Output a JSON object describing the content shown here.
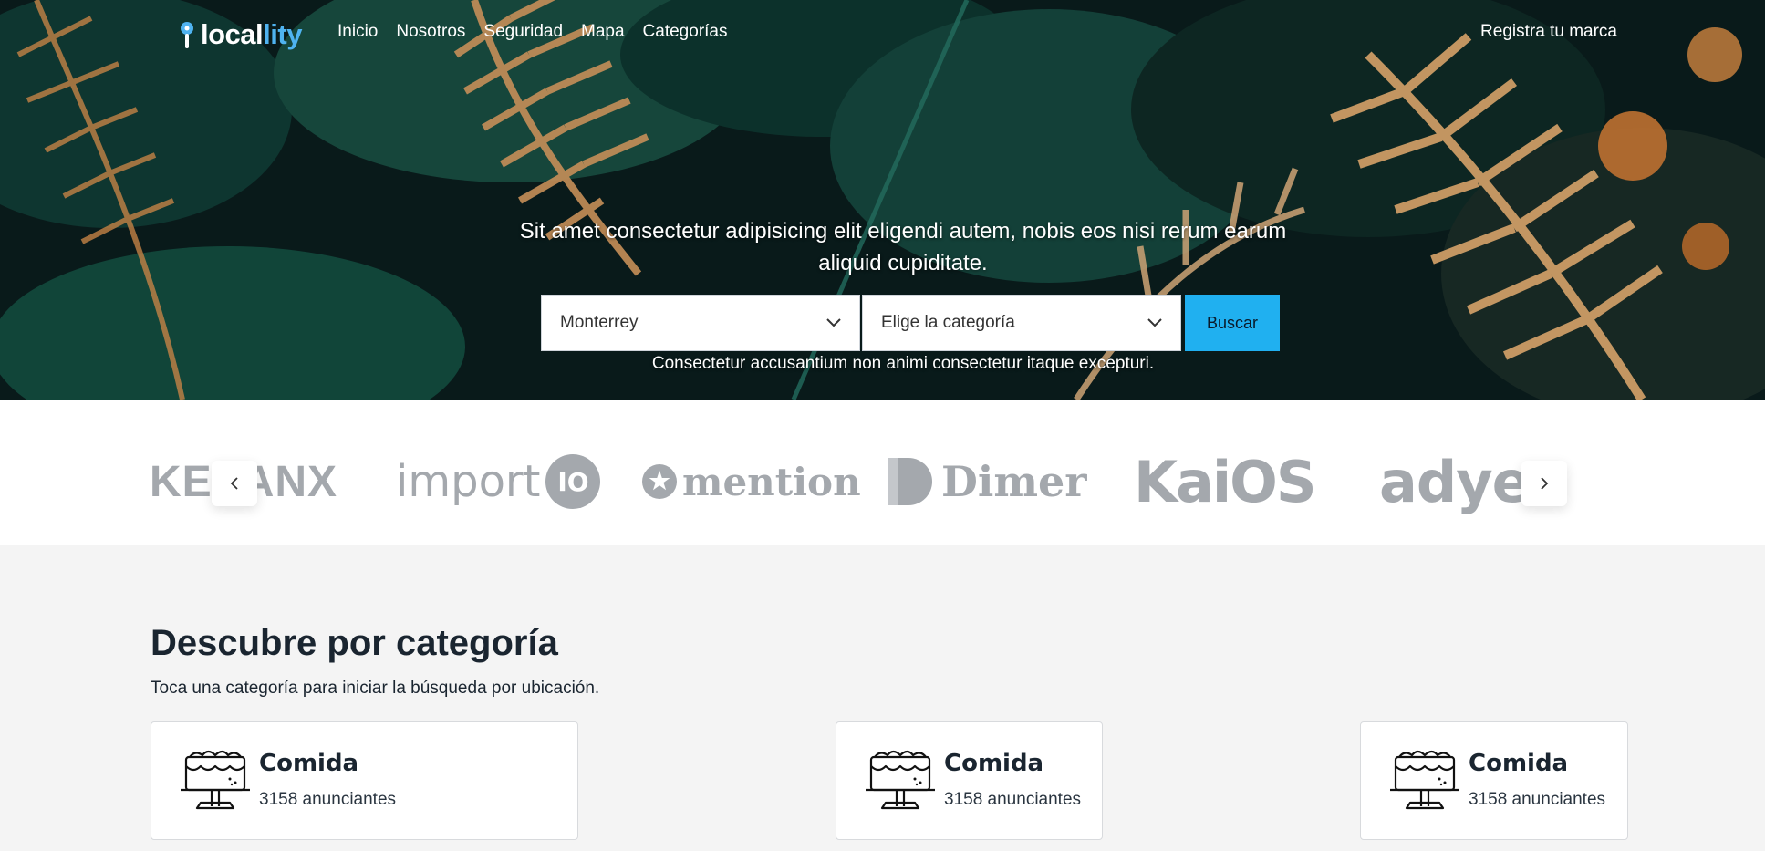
{
  "brand": {
    "logo_text_main": "local",
    "logo_text_accent": "lity"
  },
  "nav": {
    "links": [
      "Inicio",
      "Nosotros",
      "Seguridad",
      "Mapa",
      "Categorías"
    ],
    "right_link": "Registra tu marca"
  },
  "hero": {
    "tagline": "Sit amet consectetur adipisicing elit eligendi autem, nobis eos nisi rerum earum aliquid cupiditate.",
    "location_select": "Monterrey",
    "category_select": "Elige la categoría",
    "search_button": "Buscar",
    "subtext": "Consectetur accusantium non animi consectetur itaque excepturi."
  },
  "partners": {
    "logos": [
      "KEXANX",
      "import",
      "IO",
      "mention",
      "Dimer",
      "KaiOS",
      "adyen"
    ],
    "carousel_prev_icon": "chevron-left-icon",
    "carousel_next_icon": "chevron-right-icon"
  },
  "categories": {
    "title": "Descubre por categoría",
    "subtitle": "Toca una categoría para iniciar la búsqueda por ubicación.",
    "cards": [
      {
        "name": "Comida",
        "count": "3158 anunciantes",
        "icon": "cake-icon"
      },
      {
        "name": "Comida",
        "count": "3158 anunciantes",
        "icon": "cake-icon"
      },
      {
        "name": "Comida",
        "count": "3158 anunciantes",
        "icon": "cake-icon"
      }
    ]
  },
  "colors": {
    "accent": "#20b0f0",
    "logo_accent": "#4fb3f0",
    "heading": "#1a2530"
  }
}
